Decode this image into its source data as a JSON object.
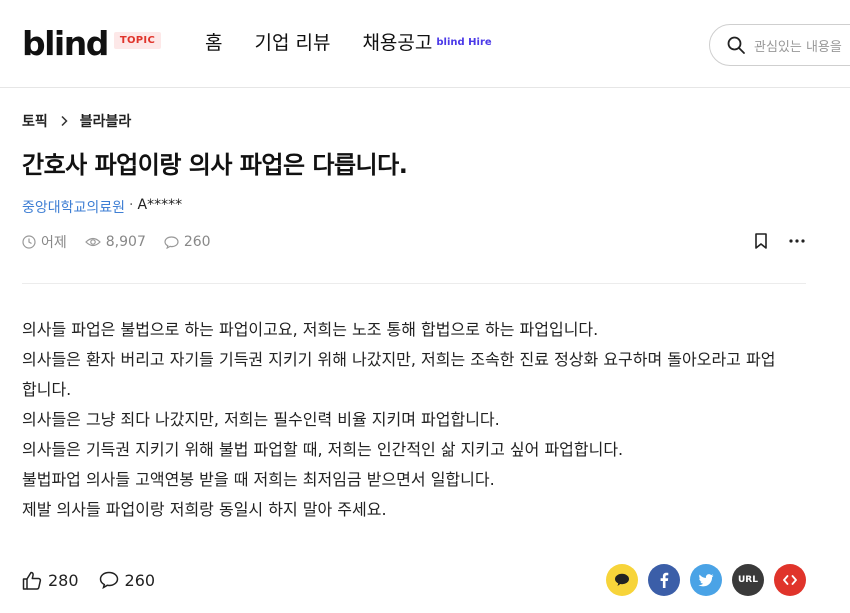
{
  "header": {
    "logo": "blind",
    "logo_badge": "TOPIC",
    "nav": [
      "홈",
      "기업 리뷰",
      "채용공고"
    ],
    "hire_badge": "blind Hire",
    "search_placeholder": "관심있는 내용을"
  },
  "breadcrumb": {
    "root": "토픽",
    "current": "블라블라"
  },
  "post": {
    "title": "간호사 파업이랑 의사 파업은 다릅니다.",
    "company": "중앙대학교의료원",
    "separator": "·",
    "author": "A*****",
    "time": "어제",
    "views": "8,907",
    "comments": "260",
    "body": [
      "의사들 파업은 불법으로 하는 파업이고요, 저희는 노조 통해 합법으로 하는 파업입니다.",
      "의사들은 환자 버리고 자기들 기득권 지키기 위해 나갔지만, 저희는 조속한 진료 정상화 요구하며 돌아오라고 파업",
      "합니다.",
      "의사들은 그냥 죄다 나갔지만, 저희는 필수인력 비율 지키며 파업합니다.",
      "의사들은 기득권 지키기 위해 불법 파업할 때, 저희는 인간적인 삶 지키고 싶어 파업합니다.",
      "불법파업 의사들 고액연봉 받을 때 저희는 최저임금 받으면서 일합니다.",
      "제발 의사들 파업이랑 저희랑 동일시 하지 말아 주세요."
    ],
    "likes": "280",
    "comments_footer": "260"
  },
  "share": {
    "url_label": "URL"
  },
  "colors": {
    "brand_red": "#e0342b",
    "company_blue": "#3f7fd4",
    "hire_purple": "#4b39e8"
  }
}
